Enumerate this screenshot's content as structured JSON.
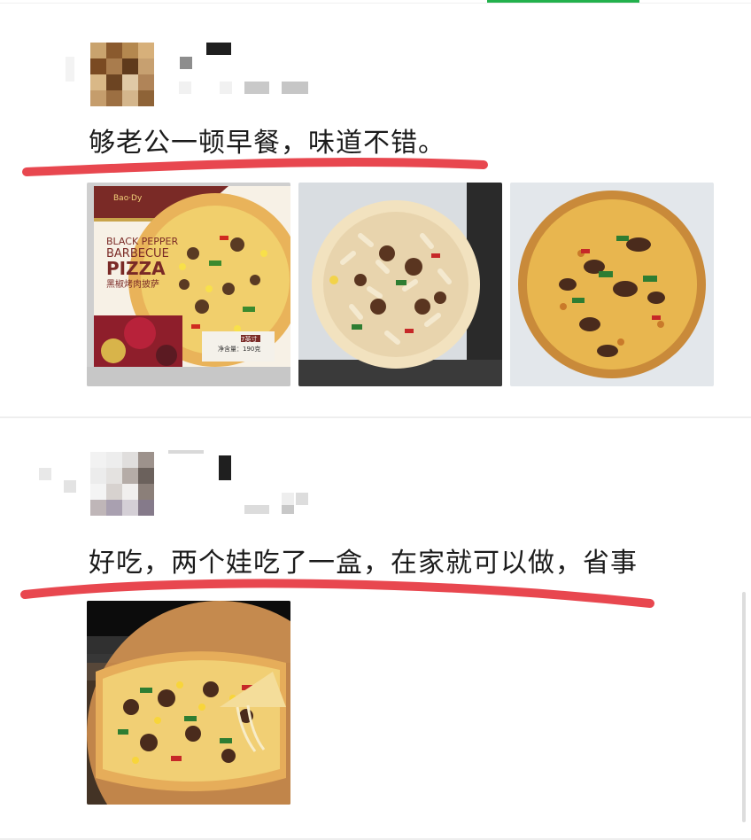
{
  "reviews": [
    {
      "text": "够老公一顿早餐，味道不错。",
      "photos": [
        {
          "kind": "pizza-box",
          "brand_logo": "Bao·Dy",
          "box_title_line1": "BLACK PEPPER",
          "box_title_line2": "BARBECUE",
          "box_title_line3": "PIZZA",
          "box_subtitle": "黑椒烤肉披萨",
          "size_label": "7英寸",
          "net_weight": "净含量：190克"
        },
        {
          "kind": "unbaked-pizza"
        },
        {
          "kind": "baked-pizza"
        }
      ]
    },
    {
      "text": "好吃，两个娃吃了一盒，在家就可以做，省事",
      "photos": [
        {
          "kind": "pizza-slice-on-board"
        }
      ]
    }
  ],
  "colors": {
    "tab_accent": "#22b14c",
    "underline_red": "#e8474f",
    "text": "#1b1b1b"
  }
}
